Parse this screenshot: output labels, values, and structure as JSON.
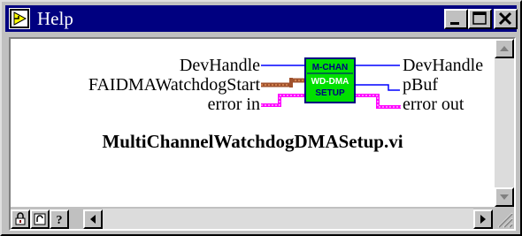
{
  "window": {
    "title": "Help"
  },
  "titlebar": {
    "controls": [
      "minimize",
      "maximize",
      "close"
    ]
  },
  "diagram": {
    "node": {
      "line1": "M-CHAN",
      "line2": "WD-DMA",
      "line3": "SETUP",
      "fill": "#00e000",
      "border": "#000080"
    },
    "inputs": [
      "DevHandle",
      "FAIDMAWatchdogStart",
      "error in"
    ],
    "outputs": [
      "DevHandle",
      "pBuf",
      "error out"
    ],
    "vi_name": "MultiChannelWatchdogDMASetup.vi",
    "wire_colors": {
      "int": "#0000ff",
      "cluster": "#a0522d",
      "error": "#ff00ff"
    }
  },
  "toolbar": {
    "icons": [
      "lock-icon",
      "hide-optional-icon",
      "help-question-icon"
    ]
  },
  "colors": {
    "titlebar": "#000080",
    "face": "#c0c0c0",
    "content": "#ffffff"
  }
}
